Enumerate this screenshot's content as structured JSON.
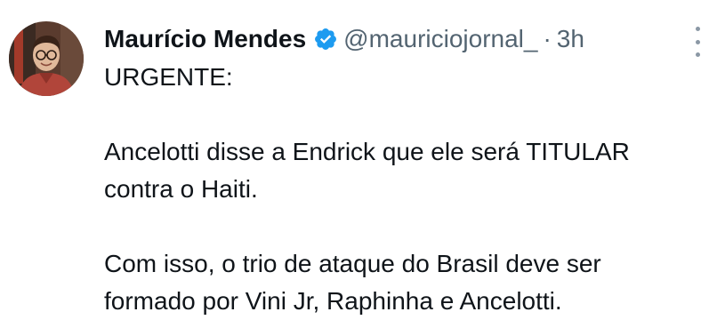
{
  "author": {
    "name": "Maurício Mendes",
    "handle": "@mauriciojornal_",
    "separator": "·",
    "time": "3h"
  },
  "tweet": {
    "line1": "URGENTE:",
    "para2_line1": "Ancelotti disse a Endrick que ele será TITULAR",
    "para2_line2": "contra o Haiti.",
    "para3_line1": "Com isso, o trio de ataque do Brasil deve ser",
    "para3_line2": "formado por Vini Jr, Raphinha e Ancelotti."
  },
  "icons": {
    "verified": "verified-badge-icon",
    "more": "more-options-icon"
  },
  "colors": {
    "verified_blue": "#1d9bf0",
    "text_primary": "#0f1419",
    "text_secondary": "#536471"
  }
}
